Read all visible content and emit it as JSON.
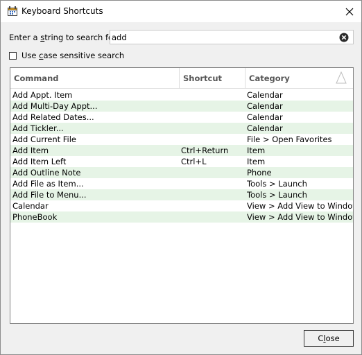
{
  "window": {
    "title": "Keyboard Shortcuts"
  },
  "search": {
    "label_pre": "Enter a ",
    "label_mnemonic": "s",
    "label_post": "tring to search for:",
    "value": "add"
  },
  "case_option": {
    "label_pre": "Use ",
    "label_mnemonic": "c",
    "label_post": "ase sensitive search",
    "checked": false
  },
  "table": {
    "columns": {
      "command": "Command",
      "shortcut": "Shortcut",
      "category": "Category"
    },
    "rows": [
      {
        "command": "Add Appt. Item",
        "shortcut": "",
        "category": "Calendar"
      },
      {
        "command": "Add Multi-Day Appt...",
        "shortcut": "",
        "category": "Calendar"
      },
      {
        "command": "Add Related Dates...",
        "shortcut": "",
        "category": "Calendar"
      },
      {
        "command": "Add Tickler...",
        "shortcut": "",
        "category": "Calendar"
      },
      {
        "command": "Add Current File",
        "shortcut": "",
        "category": "File > Open Favorites"
      },
      {
        "command": "Add Item",
        "shortcut": "Ctrl+Return",
        "category": "Item"
      },
      {
        "command": "Add Item Left",
        "shortcut": "Ctrl+L",
        "category": "Item"
      },
      {
        "command": "Add Outline Note",
        "shortcut": "",
        "category": "Phone"
      },
      {
        "command": "Add File as Item...",
        "shortcut": "",
        "category": "Tools > Launch"
      },
      {
        "command": "Add File to Menu...",
        "shortcut": "",
        "category": "Tools > Launch"
      },
      {
        "command": "Calendar",
        "shortcut": "",
        "category": "View > Add View to Window"
      },
      {
        "command": "PhoneBook",
        "shortcut": "",
        "category": "View > Add View to Window"
      }
    ]
  },
  "close_button": {
    "pre": "C",
    "mnemonic": "l",
    "post": "ose"
  },
  "colors": {
    "alt_row": "#e6f4e6",
    "header_text": "#555555"
  }
}
